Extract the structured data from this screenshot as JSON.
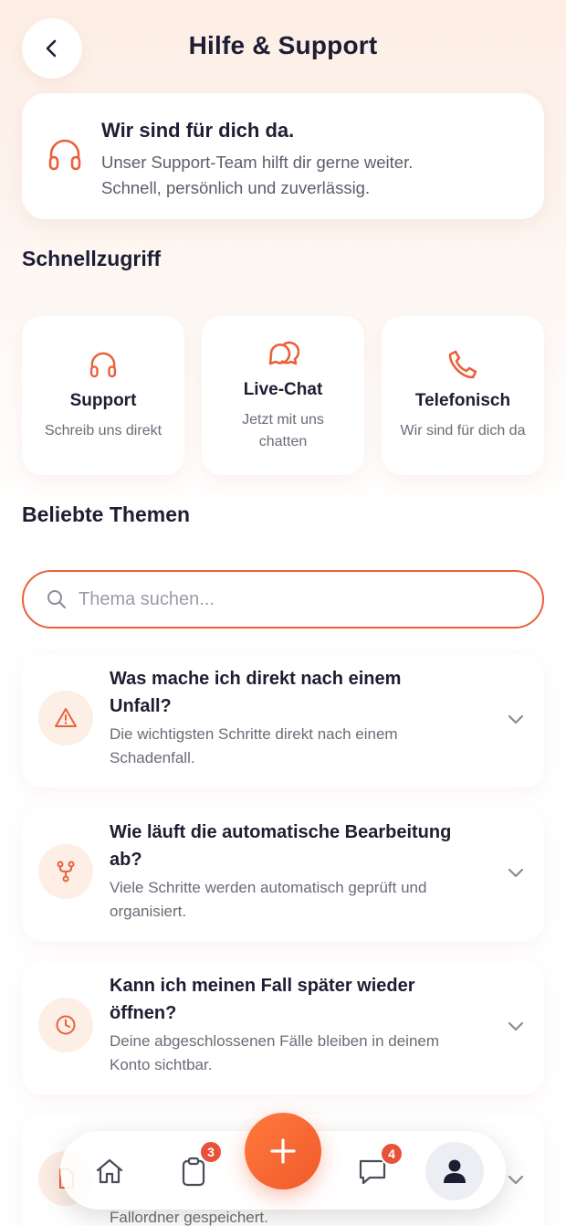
{
  "header": {
    "title": "Hilfe & Support",
    "back_icon": "chevron-left-icon"
  },
  "hero": {
    "title": "Wir sind für dich da.",
    "line1": "Unser Support-Team hilft dir gerne weiter.",
    "line2": "Schnell, persönlich und zuverlässig.",
    "icon": "headphones-icon"
  },
  "quick": {
    "title": "Schnellzugriff",
    "items": [
      {
        "label": "Support",
        "sub1": "Schreib uns direkt",
        "sub2": "",
        "icon": "headphones-icon"
      },
      {
        "label": "Live-Chat",
        "sub1": "Jetzt mit uns",
        "sub2": "chatten",
        "icon": "chat-bubbles-icon"
      },
      {
        "label": "Telefonisch",
        "sub1": "Wir sind für dich da",
        "sub2": "",
        "icon": "phone-icon"
      }
    ]
  },
  "topics": {
    "title": "Beliebte Themen",
    "search_placeholder": "Thema suchen...",
    "items": [
      {
        "title1": "Was mache ich direkt nach einem",
        "title2": "Unfall?",
        "text1": "Die wichtigsten Schritte direkt nach einem",
        "text2": "Schadenfall.",
        "icon": "warning-icon"
      },
      {
        "title1": "Wie läuft die automatische Bearbeitung",
        "title2": "ab?",
        "text1": "Viele Schritte werden automatisch geprüft und",
        "text2": "organisiert.",
        "icon": "branch-icon"
      },
      {
        "title1": "Kann ich meinen Fall später wieder",
        "title2": "öffnen?",
        "text1": "Deine abgeschlossenen Fälle bleiben in deinem",
        "text2": "Konto sichtbar.",
        "icon": "clock-icon"
      },
      {
        "title1": "",
        "title2": "",
        "text1": "",
        "text2": "Fallordner gespeichert.",
        "icon": "document-icon"
      }
    ]
  },
  "nav": {
    "cases_badge": "3",
    "messages_badge": "4",
    "accent": "#e8623c"
  }
}
